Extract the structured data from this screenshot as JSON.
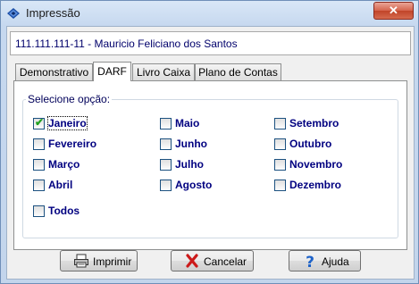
{
  "window": {
    "title": "Impressão",
    "close_label": "✕"
  },
  "header": {
    "text": "111.111.111-11 - Mauricio Feliciano dos Santos"
  },
  "tabs": [
    {
      "label": "Demonstrativo",
      "active": false
    },
    {
      "label": "DARF",
      "active": true
    },
    {
      "label": "Livro Caixa",
      "active": false
    },
    {
      "label": "Plano de Contas",
      "active": false
    }
  ],
  "options": {
    "legend": "Selecione opção:",
    "months": [
      {
        "label": "Janeiro",
        "checked": true
      },
      {
        "label": "Fevereiro",
        "checked": false
      },
      {
        "label": "Março",
        "checked": false
      },
      {
        "label": "Abril",
        "checked": false
      },
      {
        "label": "Maio",
        "checked": false
      },
      {
        "label": "Junho",
        "checked": false
      },
      {
        "label": "Julho",
        "checked": false
      },
      {
        "label": "Agosto",
        "checked": false
      },
      {
        "label": "Setembro",
        "checked": false
      },
      {
        "label": "Outubro",
        "checked": false
      },
      {
        "label": "Novembro",
        "checked": false
      },
      {
        "label": "Dezembro",
        "checked": false
      }
    ],
    "all": {
      "label": "Todos",
      "checked": false
    }
  },
  "buttons": {
    "print": {
      "label": "Imprimir",
      "icon": "printer-icon"
    },
    "cancel": {
      "label": "Cancelar",
      "icon": "red-x-icon"
    },
    "help": {
      "label": "Ajuda",
      "icon": "question-mark-icon"
    }
  },
  "colors": {
    "label_text": "#000080",
    "check_mark": "#21a121",
    "cancel_icon": "#cc1a1a",
    "help_icon": "#1e63c9"
  }
}
